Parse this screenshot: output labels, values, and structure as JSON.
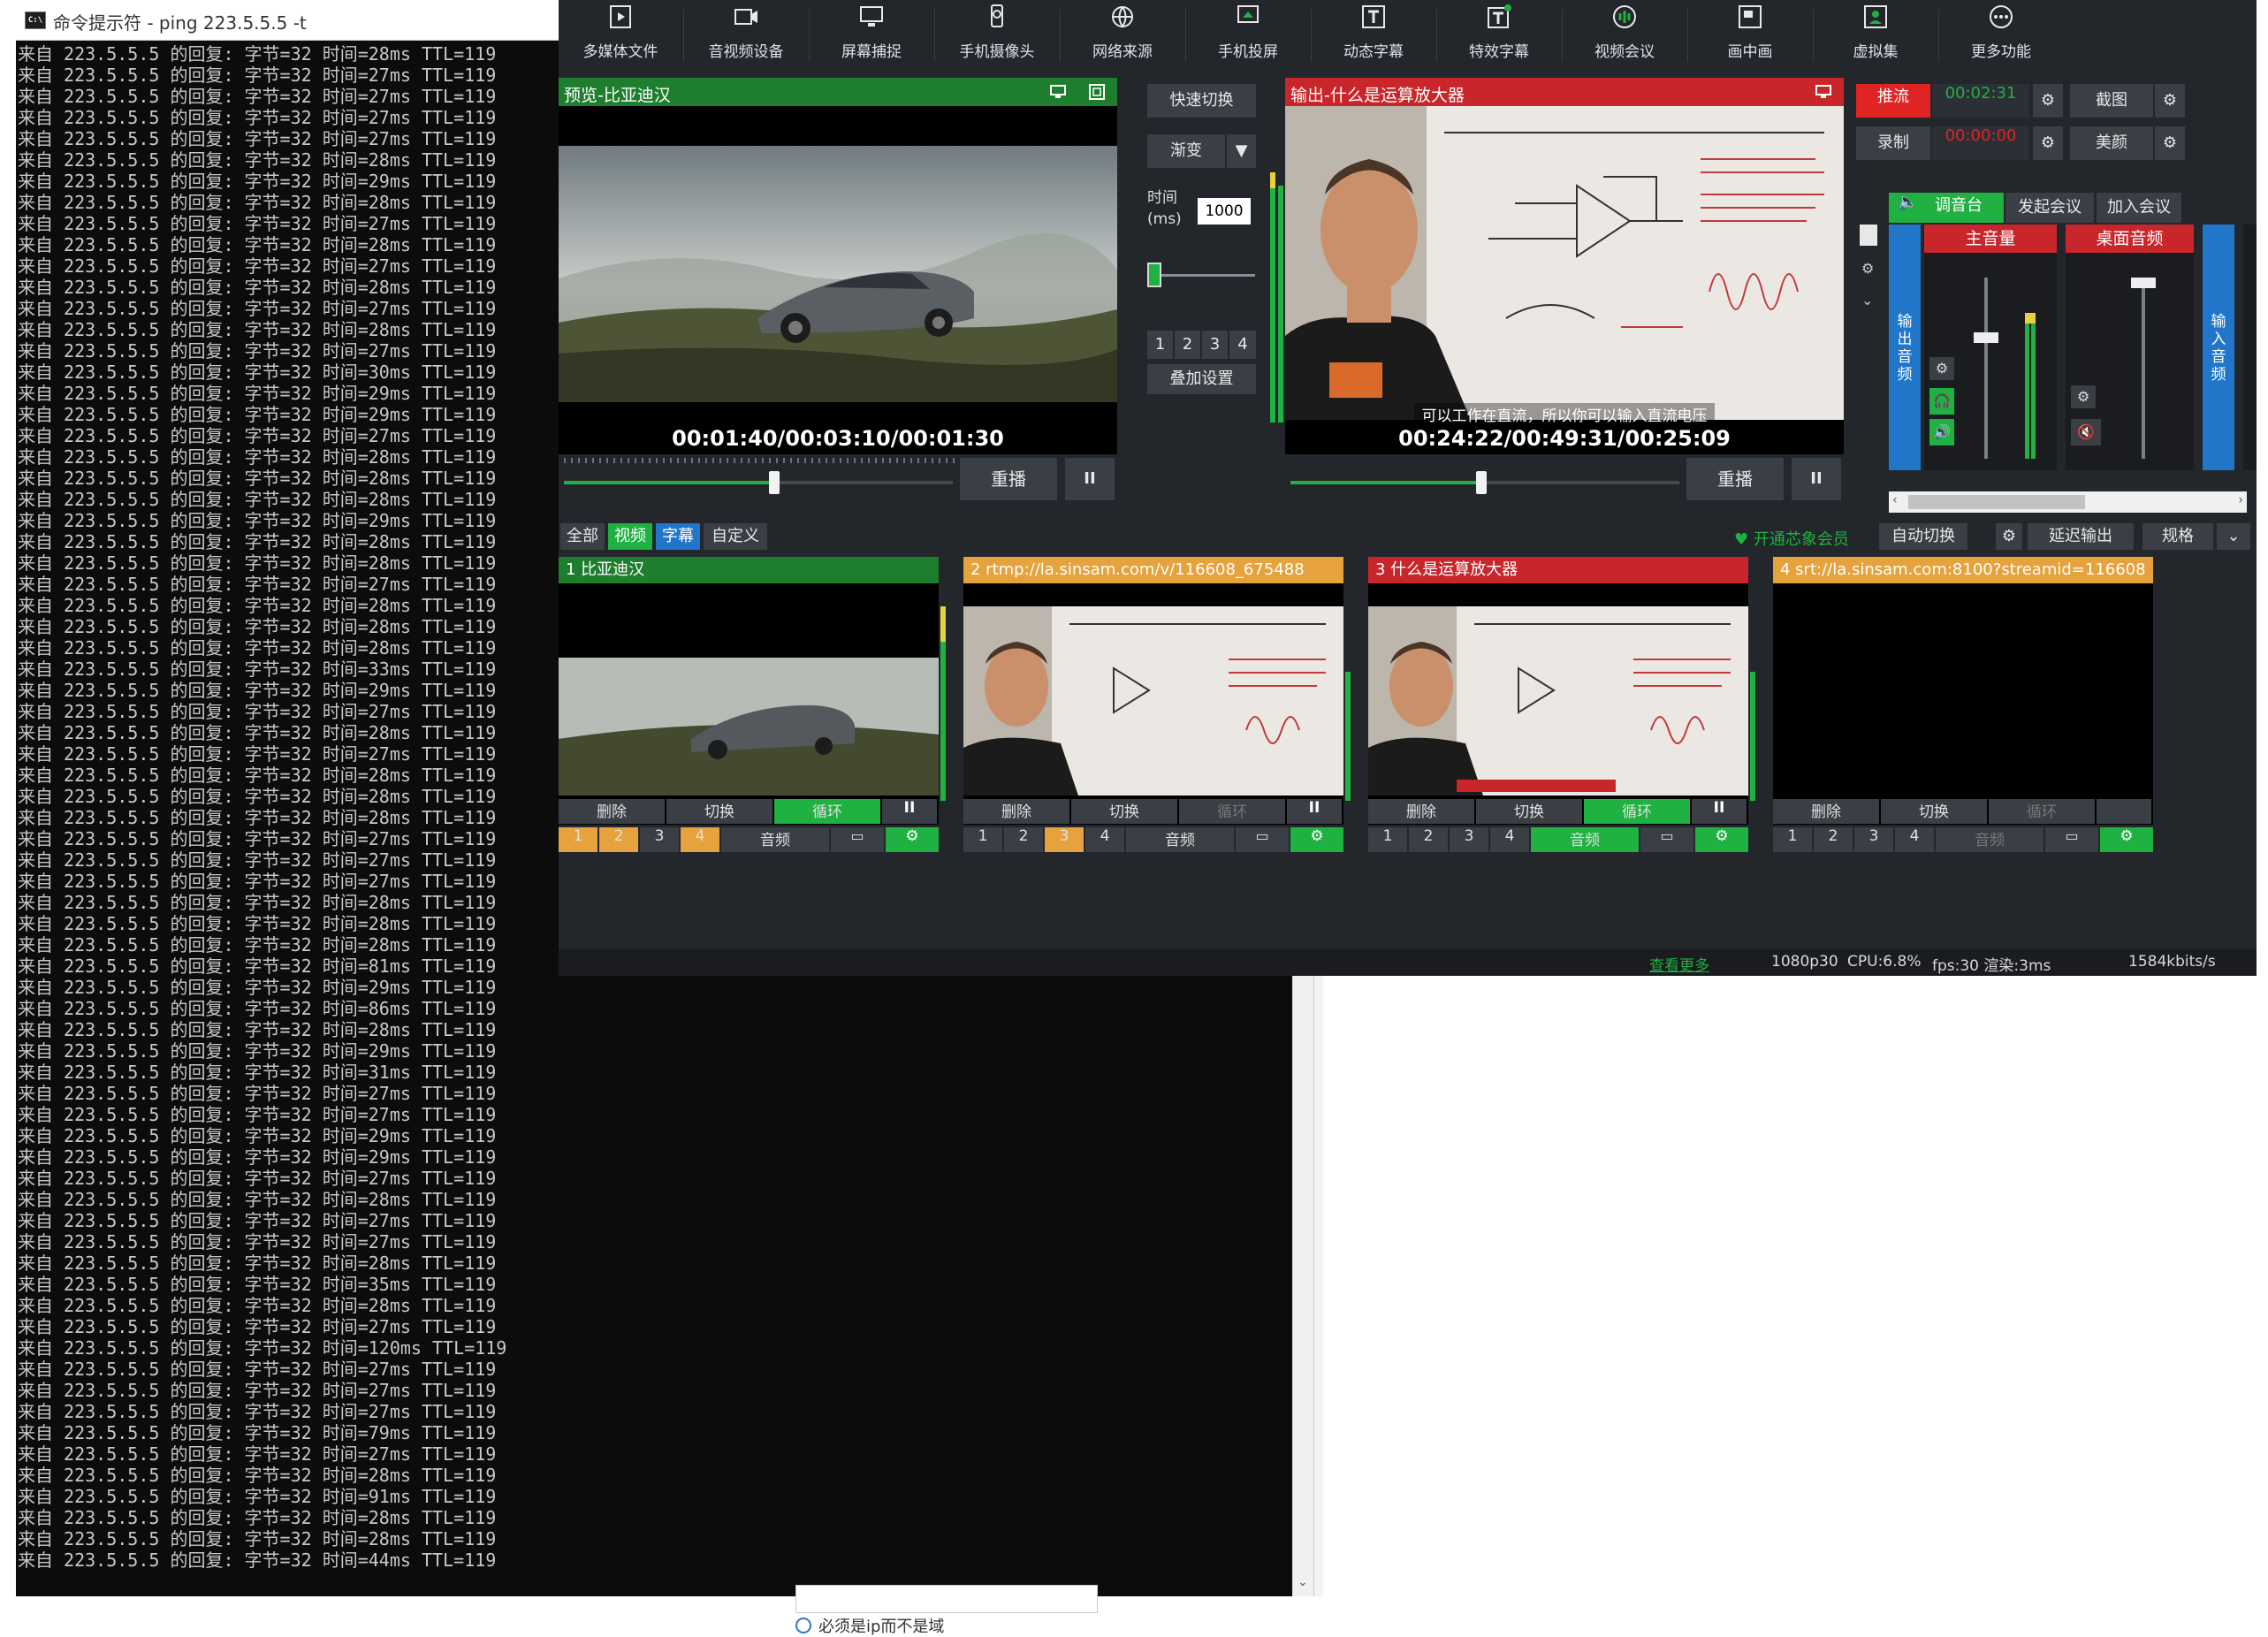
{
  "cmd": {
    "title": "命令提示符 - ping  223.5.5.5 -t",
    "lines": [
      "来自 223.5.5.5 的回复: 字节=32 时间=28ms TTL=119",
      "来自 223.5.5.5 的回复: 字节=32 时间=27ms TTL=119",
      "来自 223.5.5.5 的回复: 字节=32 时间=27ms TTL=119",
      "来自 223.5.5.5 的回复: 字节=32 时间=27ms TTL=119",
      "来自 223.5.5.5 的回复: 字节=32 时间=27ms TTL=119",
      "来自 223.5.5.5 的回复: 字节=32 时间=28ms TTL=119",
      "来自 223.5.5.5 的回复: 字节=32 时间=29ms TTL=119",
      "来自 223.5.5.5 的回复: 字节=32 时间=28ms TTL=119",
      "来自 223.5.5.5 的回复: 字节=32 时间=27ms TTL=119",
      "来自 223.5.5.5 的回复: 字节=32 时间=28ms TTL=119",
      "来自 223.5.5.5 的回复: 字节=32 时间=27ms TTL=119",
      "来自 223.5.5.5 的回复: 字节=32 时间=28ms TTL=119",
      "来自 223.5.5.5 的回复: 字节=32 时间=27ms TTL=119",
      "来自 223.5.5.5 的回复: 字节=32 时间=28ms TTL=119",
      "来自 223.5.5.5 的回复: 字节=32 时间=27ms TTL=119",
      "来自 223.5.5.5 的回复: 字节=32 时间=30ms TTL=119",
      "来自 223.5.5.5 的回复: 字节=32 时间=29ms TTL=119",
      "来自 223.5.5.5 的回复: 字节=32 时间=29ms TTL=119",
      "来自 223.5.5.5 的回复: 字节=32 时间=27ms TTL=119",
      "来自 223.5.5.5 的回复: 字节=32 时间=28ms TTL=119",
      "来自 223.5.5.5 的回复: 字节=32 时间=28ms TTL=119",
      "来自 223.5.5.5 的回复: 字节=32 时间=28ms TTL=119",
      "来自 223.5.5.5 的回复: 字节=32 时间=29ms TTL=119",
      "来自 223.5.5.5 的回复: 字节=32 时间=28ms TTL=119",
      "来自 223.5.5.5 的回复: 字节=32 时间=28ms TTL=119",
      "来自 223.5.5.5 的回复: 字节=32 时间=27ms TTL=119",
      "来自 223.5.5.5 的回复: 字节=32 时间=28ms TTL=119",
      "来自 223.5.5.5 的回复: 字节=32 时间=28ms TTL=119",
      "来自 223.5.5.5 的回复: 字节=32 时间=28ms TTL=119",
      "来自 223.5.5.5 的回复: 字节=32 时间=33ms TTL=119",
      "来自 223.5.5.5 的回复: 字节=32 时间=29ms TTL=119",
      "来自 223.5.5.5 的回复: 字节=32 时间=27ms TTL=119",
      "来自 223.5.5.5 的回复: 字节=32 时间=28ms TTL=119",
      "来自 223.5.5.5 的回复: 字节=32 时间=27ms TTL=119",
      "来自 223.5.5.5 的回复: 字节=32 时间=28ms TTL=119",
      "来自 223.5.5.5 的回复: 字节=32 时间=28ms TTL=119",
      "来自 223.5.5.5 的回复: 字节=32 时间=28ms TTL=119",
      "来自 223.5.5.5 的回复: 字节=32 时间=27ms TTL=119",
      "来自 223.5.5.5 的回复: 字节=32 时间=27ms TTL=119",
      "来自 223.5.5.5 的回复: 字节=32 时间=27ms TTL=119",
      "来自 223.5.5.5 的回复: 字节=32 时间=28ms TTL=119",
      "来自 223.5.5.5 的回复: 字节=32 时间=28ms TTL=119",
      "来自 223.5.5.5 的回复: 字节=32 时间=28ms TTL=119",
      "来自 223.5.5.5 的回复: 字节=32 时间=81ms TTL=119",
      "来自 223.5.5.5 的回复: 字节=32 时间=29ms TTL=119",
      "来自 223.5.5.5 的回复: 字节=32 时间=86ms TTL=119",
      "来自 223.5.5.5 的回复: 字节=32 时间=28ms TTL=119",
      "来自 223.5.5.5 的回复: 字节=32 时间=29ms TTL=119",
      "来自 223.5.5.5 的回复: 字节=32 时间=31ms TTL=119",
      "来自 223.5.5.5 的回复: 字节=32 时间=27ms TTL=119",
      "来自 223.5.5.5 的回复: 字节=32 时间=27ms TTL=119",
      "来自 223.5.5.5 的回复: 字节=32 时间=29ms TTL=119",
      "来自 223.5.5.5 的回复: 字节=32 时间=29ms TTL=119",
      "来自 223.5.5.5 的回复: 字节=32 时间=27ms TTL=119",
      "来自 223.5.5.5 的回复: 字节=32 时间=28ms TTL=119",
      "来自 223.5.5.5 的回复: 字节=32 时间=27ms TTL=119",
      "来自 223.5.5.5 的回复: 字节=32 时间=27ms TTL=119",
      "来自 223.5.5.5 的回复: 字节=32 时间=28ms TTL=119",
      "来自 223.5.5.5 的回复: 字节=32 时间=35ms TTL=119",
      "来自 223.5.5.5 的回复: 字节=32 时间=28ms TTL=119",
      "来自 223.5.5.5 的回复: 字节=32 时间=27ms TTL=119",
      "来自 223.5.5.5 的回复: 字节=32 时间=120ms TTL=119",
      "来自 223.5.5.5 的回复: 字节=32 时间=27ms TTL=119",
      "来自 223.5.5.5 的回复: 字节=32 时间=27ms TTL=119",
      "来自 223.5.5.5 的回复: 字节=32 时间=27ms TTL=119",
      "来自 223.5.5.5 的回复: 字节=32 时间=79ms TTL=119",
      "来自 223.5.5.5 的回复: 字节=32 时间=27ms TTL=119",
      "来自 223.5.5.5 的回复: 字节=32 时间=28ms TTL=119",
      "来自 223.5.5.5 的回复: 字节=32 时间=91ms TTL=119",
      "来自 223.5.5.5 的回复: 字节=32 时间=28ms TTL=119",
      "来自 223.5.5.5 的回复: 字节=32 时间=28ms TTL=119",
      "来自 223.5.5.5 的回复: 字节=32 时间=44ms TTL=119"
    ],
    "scroll_arrow": "⌄"
  },
  "background": {
    "caption": "必须是ip而不是域"
  },
  "toolbar": [
    {
      "label": "多媒体文件",
      "icon": "media-file-icon"
    },
    {
      "label": "音视频设备",
      "icon": "av-device-icon"
    },
    {
      "label": "屏幕捕捉",
      "icon": "screen-capture-icon"
    },
    {
      "label": "手机摄像头",
      "icon": "phone-camera-icon"
    },
    {
      "label": "网络来源",
      "icon": "network-source-icon"
    },
    {
      "label": "手机投屏",
      "icon": "phone-cast-icon"
    },
    {
      "label": "动态字幕",
      "icon": "dynamic-subtitle-icon"
    },
    {
      "label": "特效字幕",
      "icon": "effect-subtitle-icon"
    },
    {
      "label": "视频会议",
      "icon": "video-conference-icon"
    },
    {
      "label": "画中画",
      "icon": "picture-in-picture-icon"
    },
    {
      "label": "虚拟集",
      "icon": "virtual-set-icon"
    },
    {
      "label": "更多功能",
      "icon": "more-features-icon"
    }
  ],
  "preview": {
    "title": "预览-比亚迪汉",
    "timecode": "00:01:40/00:03:10/00:01:30",
    "replay": "重播",
    "pause": "II",
    "progress": 0.54
  },
  "transition": {
    "quick": "快速切换",
    "fade": "渐变",
    "time_label_1": "时间",
    "time_label_2": "(ms)",
    "time_value": "1000",
    "layers": [
      "1",
      "2",
      "3",
      "4"
    ],
    "overlay": "叠加设置"
  },
  "output": {
    "title": "输出-什么是运算放大器",
    "timecode": "00:24:22/00:49:31/00:25:09",
    "subtitle": "可以工作在直流，所以你可以输入直流电压",
    "replay": "重播",
    "pause": "II",
    "progress": 0.49
  },
  "stream": {
    "push": "推流",
    "push_time": "00:02:31",
    "record": "录制",
    "record_time": "00:00:00",
    "screenshot": "截图",
    "beauty": "美颜"
  },
  "mixer": {
    "tab": "调音台",
    "start_meeting": "发起会议",
    "join_meeting": "加入会议",
    "master": "主音量",
    "desktop": "桌面音频",
    "output_audio": "输出音频",
    "input_audio": "输入音频"
  },
  "filters": {
    "all": "全部",
    "video": "视频",
    "subtitle": "字幕",
    "custom": "自定义"
  },
  "right_bar": {
    "member": "开通芯象会员",
    "auto_switch": "自动切换",
    "delay_output": "延迟输出",
    "spec": "规格"
  },
  "sources": [
    {
      "title": "1 比亚迪汉",
      "head": "green",
      "delete": "删除",
      "switch": "切换",
      "loop": "循环",
      "pause": "II",
      "layers": [
        "1",
        "2",
        "3",
        "4"
      ],
      "audio": "音频"
    },
    {
      "title": "2 rtmp://la.sinsam.com/v/116608_675488",
      "head": "yellow",
      "delete": "删除",
      "switch": "切换",
      "loop": "循环",
      "pause": "II",
      "layers": [
        "1",
        "2",
        "3",
        "4"
      ],
      "audio": "音频"
    },
    {
      "title": "3 什么是运算放大器",
      "head": "red",
      "delete": "删除",
      "switch": "切换",
      "loop": "循环",
      "pause": "II",
      "layers": [
        "1",
        "2",
        "3",
        "4"
      ],
      "audio": "音频"
    },
    {
      "title": "4  srt://la.sinsam.com:8100?streamid=116608",
      "head": "yellow",
      "delete": "删除",
      "switch": "切换",
      "loop": "循环",
      "layers": [
        "1",
        "2",
        "3",
        "4"
      ],
      "audio": "音频"
    }
  ],
  "status": {
    "link": "查看更多",
    "resolution": "1080p30",
    "cpu": "CPU:6.8%",
    "fps": "fps:30 渲染:3ms",
    "bitrate": "1584kbits/s"
  },
  "colors": {
    "accent_green": "#1fb141",
    "head_green": "#1d7f2e",
    "head_red": "#c8262b",
    "head_yellow": "#e6a23c",
    "push_red": "#e02424",
    "mixer_blue": "#2176c9"
  }
}
